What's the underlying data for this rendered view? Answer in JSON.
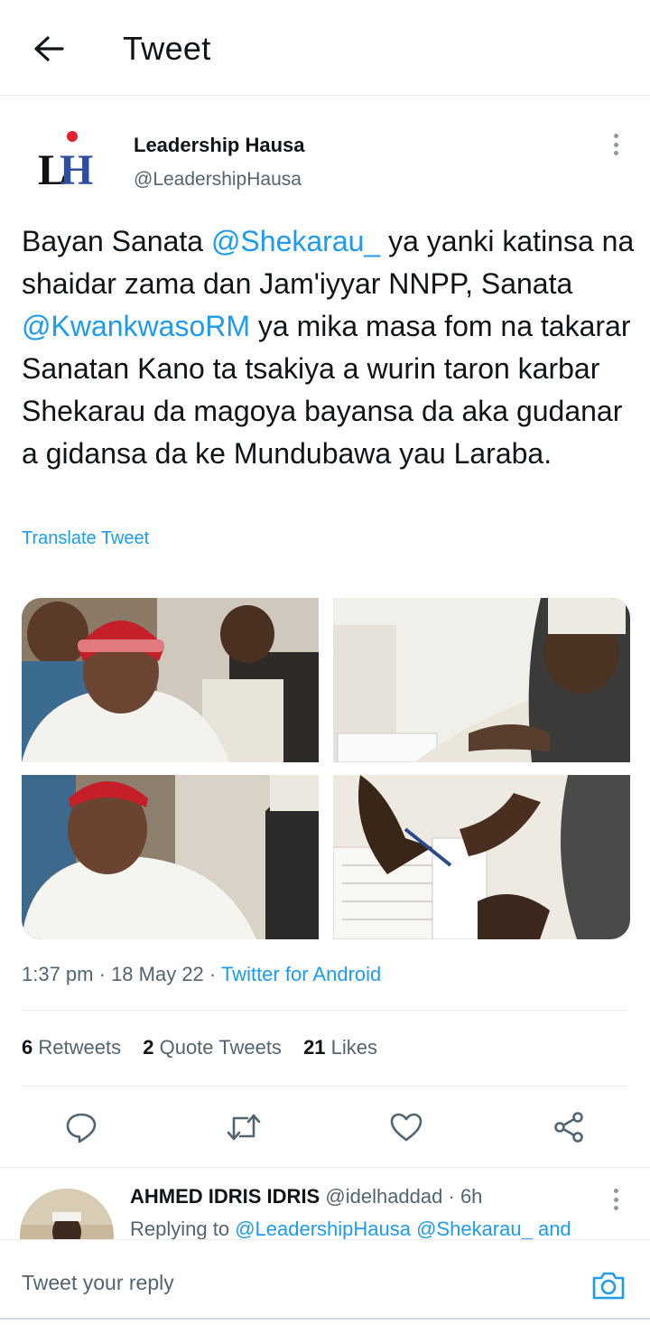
{
  "header": {
    "title": "Tweet"
  },
  "tweet": {
    "author": {
      "name": "Leadership Hausa",
      "handle": "@LeadershipHausa",
      "logo_text": "LH"
    },
    "text_segments": [
      {
        "text": "Bayan Sanata ",
        "type": "text"
      },
      {
        "text": "@Shekarau_",
        "type": "mention"
      },
      {
        "text": " ya yanki katinsa na shaidar zama dan Jam'iyyar NNPP, Sanata ",
        "type": "text"
      },
      {
        "text": "@KwankwasoRM",
        "type": "mention"
      },
      {
        "text": " ya mika masa fom na takarar Sanatan Kano ta tsakiya a wurin taron karbar Shekarau da magoya bayansa da aka gudanar a gidansa da ke Mundubawa yau Laraba.",
        "type": "text"
      }
    ],
    "translate_label": "Translate Tweet",
    "time": "1:37 pm",
    "date": "18 May 22",
    "separator": " · ",
    "source": "Twitter for Android",
    "stats": {
      "retweets_count": "6",
      "retweets_label": "Retweets",
      "quotes_count": "2",
      "quotes_label": "Quote Tweets",
      "likes_count": "21",
      "likes_label": "Likes"
    },
    "actions": [
      {
        "name": "reply",
        "icon": "comment-icon"
      },
      {
        "name": "retweet",
        "icon": "retweet-icon"
      },
      {
        "name": "like",
        "icon": "heart-icon"
      },
      {
        "name": "share",
        "icon": "share-icon"
      }
    ]
  },
  "reply": {
    "name": "AHMED IDRIS IDRIS",
    "handle": "@idelhaddad",
    "time": "6h",
    "replying_prefix": "Replying to ",
    "replying_mentions": "@LeadershipHausa @Shekarau_",
    "replying_suffix": " and"
  },
  "composer": {
    "placeholder": "Tweet your reply"
  },
  "colors": {
    "accent": "#1d9bf0",
    "text": "#0f1419",
    "secondary": "#536471",
    "divider": "#e6ecf0"
  }
}
